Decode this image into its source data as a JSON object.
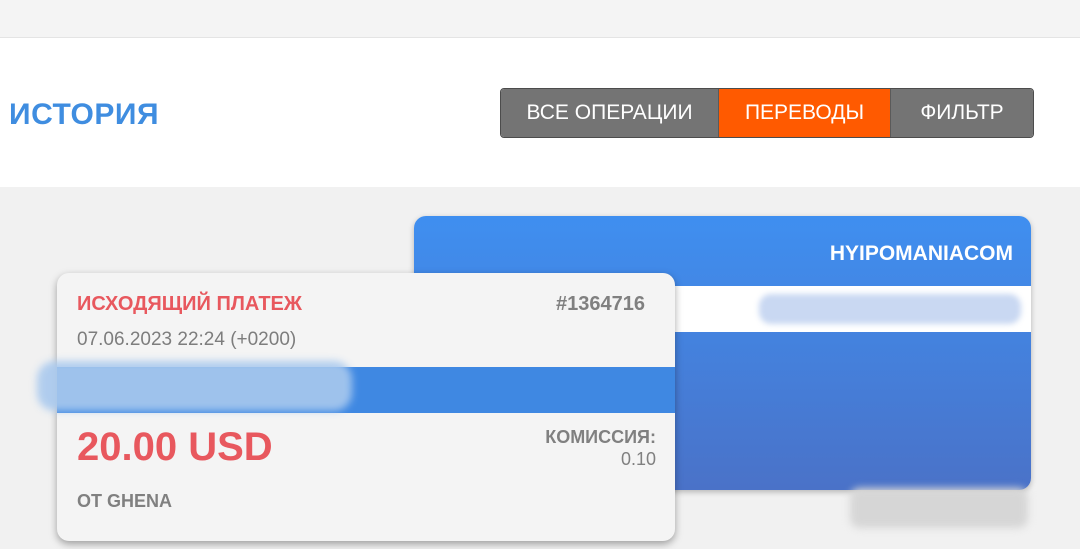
{
  "header": {
    "title": "ИСТОРИЯ"
  },
  "tabs": [
    {
      "label": "ВСЕ ОПЕРАЦИИ",
      "active": false
    },
    {
      "label": "ПЕРЕВОДЫ",
      "active": true
    },
    {
      "label": "ФИЛЬТР",
      "active": false
    }
  ],
  "colors": {
    "accent": "#ff5a00",
    "title": "#3f8de0",
    "outgoing": "#e8585e",
    "card_back": "#3f8ff0"
  },
  "back_card": {
    "title": "HYIPOMANIACOM"
  },
  "transaction": {
    "type": "ИСХОДЯЩИЙ ПЛАТЕЖ",
    "id": "#1364716",
    "datetime": "07.06.2023 22:24 (+0200)",
    "amount": "20.00 USD",
    "fee_label": "КОМИССИЯ:",
    "fee_value": "0.10",
    "from": "ОТ GHENA"
  }
}
